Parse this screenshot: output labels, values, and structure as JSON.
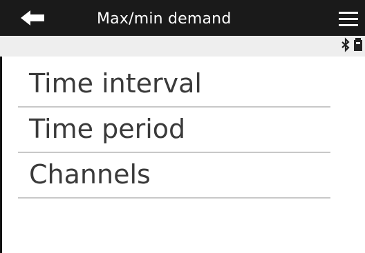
{
  "header": {
    "title": "Max/min demand",
    "back_icon": "left-arrow-icon",
    "menu_icon": "hamburger-menu-icon"
  },
  "status": {
    "icons": [
      "bluetooth-icon",
      "battery-icon"
    ]
  },
  "menu": {
    "items": [
      {
        "label": "Time interval"
      },
      {
        "label": "Time period"
      },
      {
        "label": "Channels"
      }
    ]
  },
  "colors": {
    "title_bar": "#1a1a1a",
    "title_text": "#ffffff",
    "status_strip": "#eeeeee",
    "item_text": "#3a3a3a",
    "divider": "#c8c8c8"
  }
}
